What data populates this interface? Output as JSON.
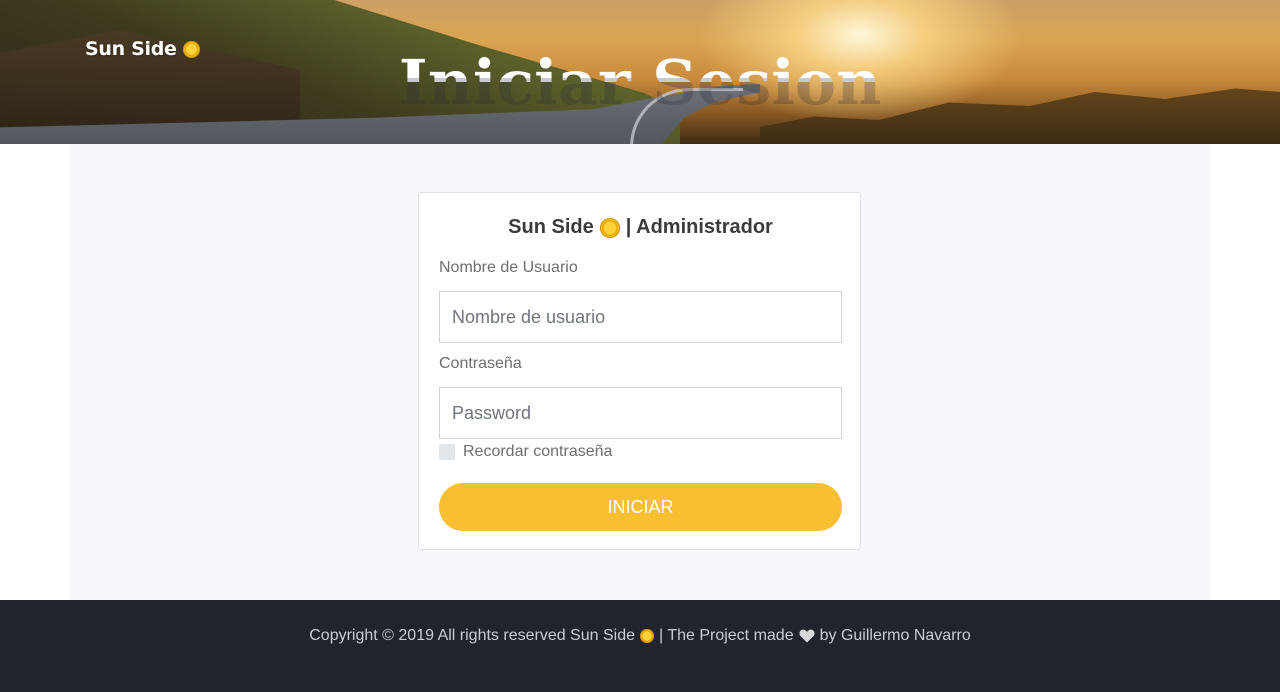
{
  "header": {
    "brand": "Sun Side",
    "brand_icon": "sun-icon",
    "hero_title": "Iniciar Sesion"
  },
  "login_card": {
    "title_prefix": "Sun Side",
    "title_icon": "sun-icon",
    "title_suffix": "| Administrador",
    "username_label": "Nombre de Usuario",
    "username_placeholder": "Nombre de usuario",
    "username_value": "",
    "password_label": "Contraseña",
    "password_placeholder": "Password",
    "password_value": "",
    "remember_label": "Recordar contraseña",
    "remember_checked": false,
    "submit_label": "INICIAR"
  },
  "footer": {
    "copyright_prefix": "Copyright © 2019 All rights reserved Sun Side",
    "copyright_middle": "| The Project made",
    "copyright_suffix": "by Guillermo Navarro",
    "icons": [
      "sun-icon",
      "heart-icon"
    ]
  },
  "colors": {
    "accent": "#f8bf32",
    "footer_bg": "#1f242d",
    "main_bg": "#f7f8fd"
  }
}
